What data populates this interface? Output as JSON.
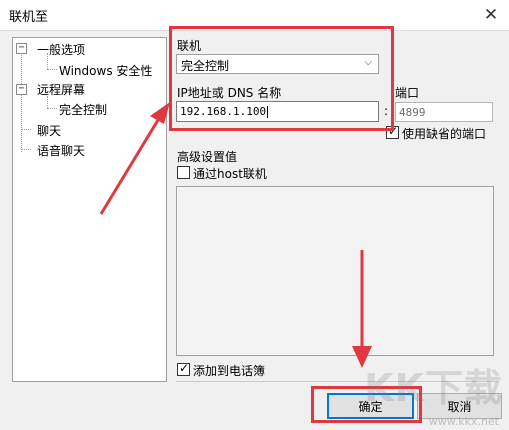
{
  "window": {
    "title": "联机至"
  },
  "tree": {
    "items": [
      {
        "label": "一般选项"
      },
      {
        "label": "Windows 安全性"
      },
      {
        "label": "远程屏幕"
      },
      {
        "label": "完全控制"
      },
      {
        "label": "聊天"
      },
      {
        "label": "语音聊天"
      }
    ]
  },
  "form": {
    "connection_label": "联机",
    "connection_mode": "完全控制",
    "ip_label": "IP地址或 DNS 名称",
    "ip_value": "192.168.1.100",
    "port_label": "端口",
    "port_sep": ":",
    "port_value": "4899",
    "use_default_port_label": "使用缺省的端口",
    "use_default_port_checked": true,
    "advanced_label": "高级设置值",
    "via_host_label": "通过host联机",
    "via_host_checked": false,
    "add_phonebook_label": "添加到电话簿",
    "add_phonebook_checked": true
  },
  "buttons": {
    "ok": "确定",
    "cancel": "取消"
  },
  "watermark": {
    "text": "KK下载",
    "url_text": "www.kkx.net"
  },
  "colors": {
    "highlight": "#e0383f",
    "focus_blue": "#0078d7"
  }
}
